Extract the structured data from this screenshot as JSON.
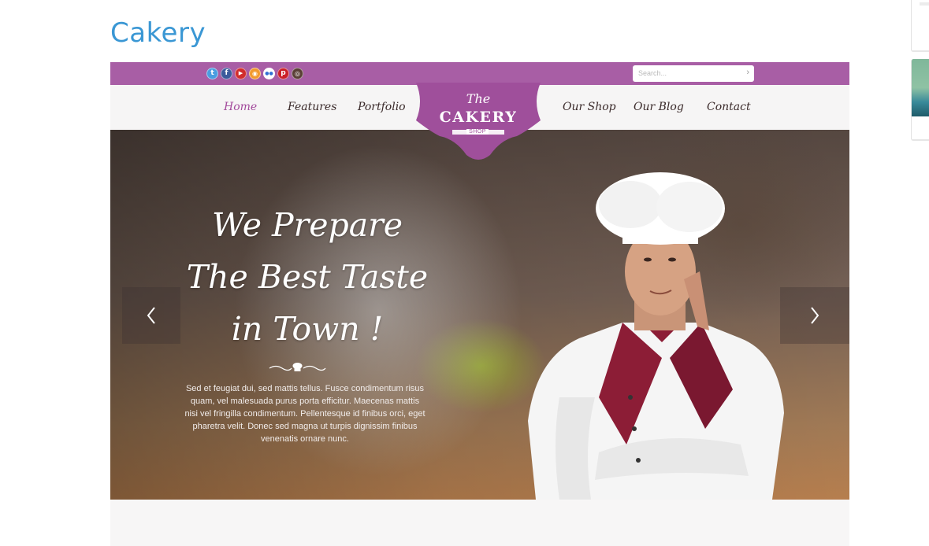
{
  "page": {
    "title": "Cakery"
  },
  "topbar": {
    "social_icons": [
      {
        "name": "twitter-icon",
        "glyph": "t",
        "color": "#4a9de0"
      },
      {
        "name": "facebook-icon",
        "glyph": "f",
        "color": "#3b5b9c"
      },
      {
        "name": "youtube-icon",
        "glyph": "▶",
        "color": "#d12d2d"
      },
      {
        "name": "rss-icon",
        "glyph": "◉",
        "color": "#f29a2e"
      },
      {
        "name": "flickr-icon",
        "glyph": "●●",
        "color": "#ffffff"
      },
      {
        "name": "pinterest-icon",
        "glyph": "p",
        "color": "#cb2028"
      },
      {
        "name": "instagram-icon",
        "glyph": "◎",
        "color": "#5a4036"
      }
    ],
    "search": {
      "placeholder": "Search...",
      "button_glyph": "›"
    }
  },
  "nav": {
    "items": [
      {
        "label": "Home",
        "active": true
      },
      {
        "label": "Features",
        "active": false
      },
      {
        "label": "Portfolio",
        "active": false
      },
      {
        "label": "Our Shop",
        "active": false
      },
      {
        "label": "Our Blog",
        "active": false
      },
      {
        "label": "Contact",
        "active": false
      }
    ]
  },
  "logo": {
    "line1": "The",
    "line2": "CAKERY",
    "line3": "SHOP"
  },
  "hero": {
    "headline": [
      "We Prepare",
      "The Best Taste",
      "in Town !"
    ],
    "body": "Sed et feugiat dui, sed mattis tellus. Fusce condimentum risus quam, vel malesuada purus porta efficitur. Maecenas mattis nisi vel fringilla condimentum. Pellentesque id finibus orci, eget pharetra velit. Donec sed magna ut turpis dignissim finibus venenatis ornare nunc.",
    "prev_glyph": "‹",
    "next_glyph": "›"
  },
  "colors": {
    "brand_purple": "#a85ea5",
    "title_blue": "#3a97d4",
    "active_nav": "#a34a9c"
  }
}
